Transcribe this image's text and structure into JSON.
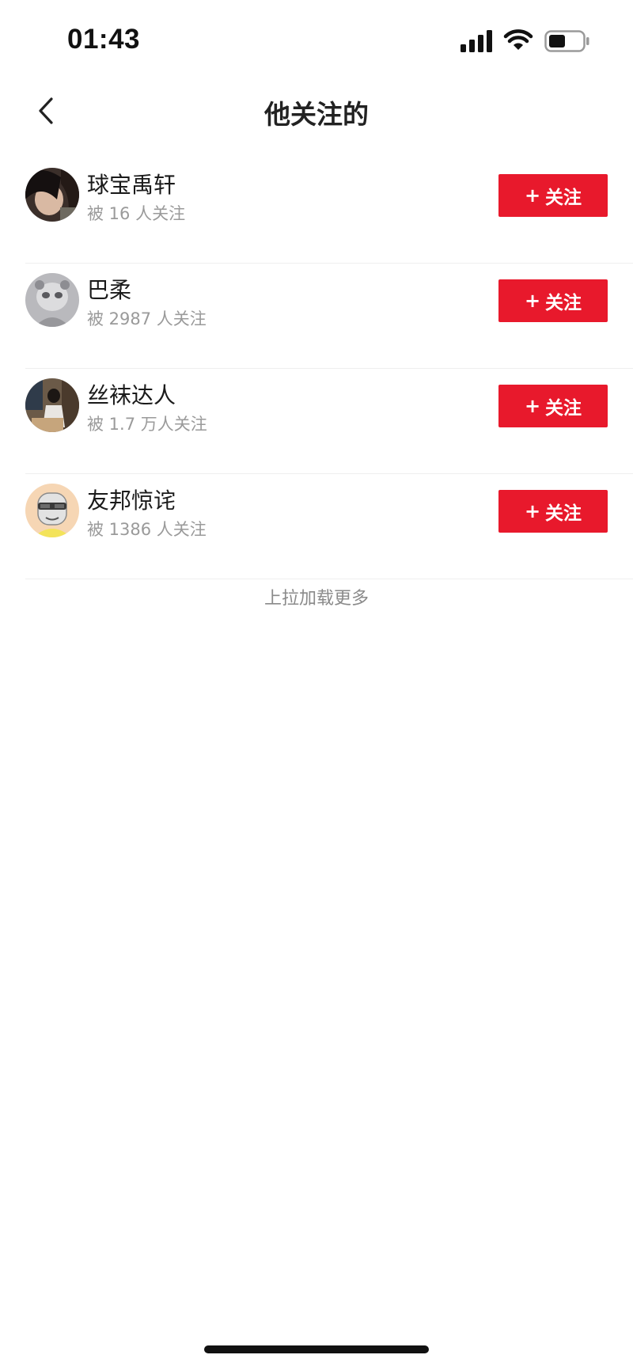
{
  "status_bar": {
    "time": "01:43"
  },
  "nav": {
    "title": "他关注的",
    "back_icon": "chevron-left-icon"
  },
  "users": [
    {
      "name": "球宝禹轩",
      "followers": "被 16 人关注",
      "button": "关注",
      "plus": "+"
    },
    {
      "name": "巴柔",
      "followers": "被 2987 人关注",
      "button": "关注",
      "plus": "+"
    },
    {
      "name": "丝袜达人",
      "followers": "被 1.7 万人关注",
      "button": "关注",
      "plus": "+"
    },
    {
      "name": "友邦惊诧",
      "followers": "被 1386 人关注",
      "button": "关注",
      "plus": "+"
    }
  ],
  "footer": {
    "load_more": "上拉加载更多"
  },
  "colors": {
    "accent": "#e8192c",
    "secondary_text": "#9a9a9a",
    "divider": "#efefef"
  }
}
